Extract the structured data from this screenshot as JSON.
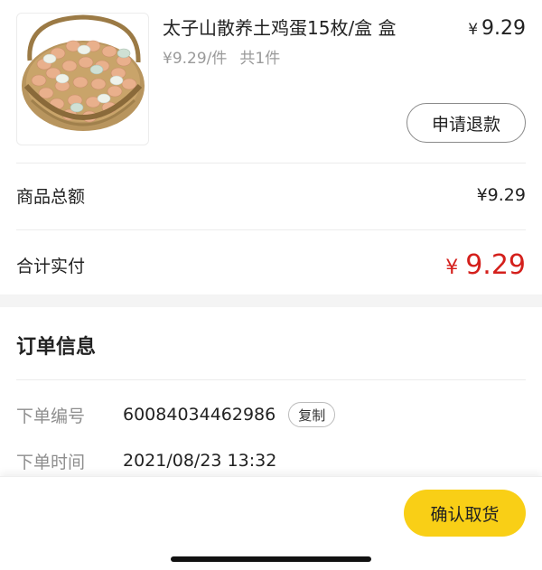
{
  "product": {
    "title": "太子山散养土鸡蛋15枚/盒 盒",
    "price_currency": "¥",
    "price": "9.29",
    "unit_price": "¥9.29/件",
    "quantity": "共1件",
    "refund_label": "申请退款"
  },
  "summary": {
    "goods_total_label": "商品总额",
    "goods_total_value": "¥9.29",
    "paid_label": "合计实付",
    "paid_currency": "¥",
    "paid_value": "9.29"
  },
  "order_info": {
    "section_title": "订单信息",
    "order_no_label": "下单编号",
    "order_no_value": "60084034462986",
    "copy_label": "复制",
    "order_time_label": "下单时间",
    "order_time_value": "2021/08/23 13:32"
  },
  "footer": {
    "confirm_label": "确认取货"
  },
  "colors": {
    "accent_yellow": "#f9cf16",
    "price_red": "#d4201c"
  }
}
